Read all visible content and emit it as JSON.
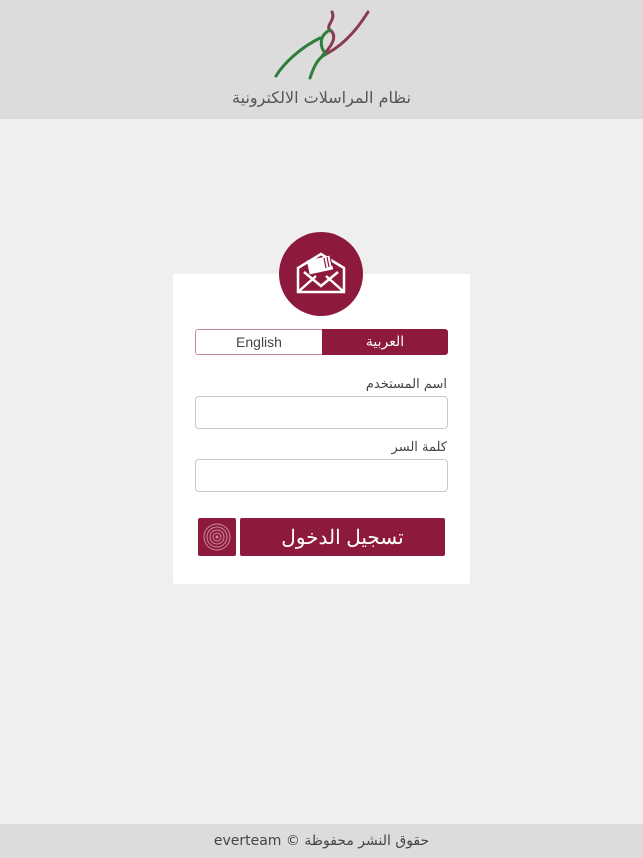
{
  "header": {
    "logo_icon": "calligraphy-logo-icon",
    "title": "نظام المراسلات الالكترونية"
  },
  "login": {
    "badge_icon": "envelope-icon",
    "language": {
      "english_label": "English",
      "arabic_label": "العربية",
      "selected": "العربية"
    },
    "username_label": "اسم المستخدم",
    "username_value": "",
    "password_label": "كلمة السر",
    "password_value": "",
    "fingerprint_icon": "fingerprint-icon",
    "login_label": "تسجيل الدخول"
  },
  "colors": {
    "accent": "#8d1a3c",
    "logo_green": "#2e7d3a"
  },
  "footer": {
    "copyright": "حقوق النشر محفوظة © everteam"
  }
}
